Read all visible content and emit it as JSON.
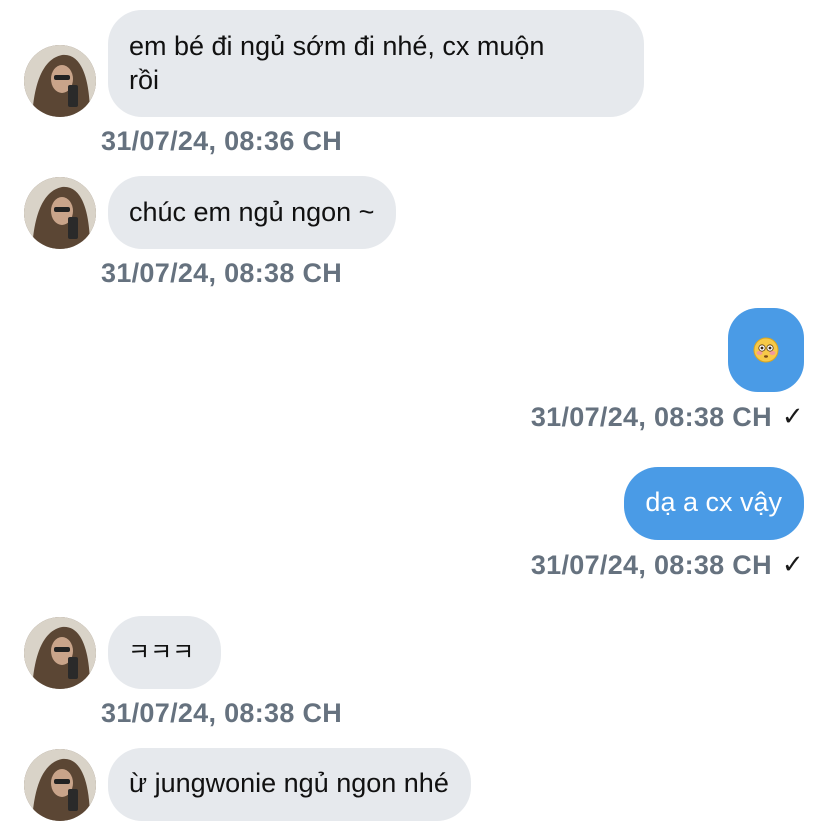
{
  "colors": {
    "incoming_bubble": "#e6e9ed",
    "outgoing_bubble": "#4a9be6",
    "timestamp": "#66727f"
  },
  "messages": [
    {
      "direction": "in",
      "text": "em bé đi ngủ sớm đi nhé, cx muộn\nrồi",
      "time": "31/07/24, 08:36 CH"
    },
    {
      "direction": "in",
      "text": "chúc em ngủ ngon ~",
      "time": "31/07/24, 08:38 CH"
    },
    {
      "direction": "out",
      "emoji": "flushed-face-emoji",
      "time": "31/07/24, 08:38 CH",
      "status": "✓"
    },
    {
      "direction": "out",
      "text": "dạ a cx vậy",
      "time": "31/07/24, 08:38 CH",
      "status": "✓"
    },
    {
      "direction": "in",
      "text": "ㅋㅋㅋ",
      "time": "31/07/24, 08:38 CH"
    },
    {
      "direction": "in",
      "text": "ừ jungwonie ngủ ngon nhé"
    }
  ]
}
